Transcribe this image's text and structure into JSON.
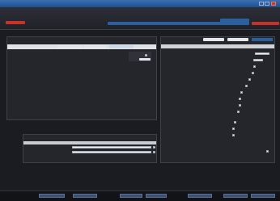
{
  "window": {
    "title": "",
    "menu": [
      "",
      "",
      "",
      "",
      ""
    ]
  },
  "header": {
    "nav": [
      "",
      "",
      "",
      "",
      ""
    ],
    "alert_label": ""
  },
  "left_panel": {
    "title": "",
    "tabs": [
      "",
      "",
      ""
    ],
    "action_button": "",
    "status_label": ""
  },
  "lower_panel": {
    "title": "",
    "rows": [
      {
        "label": "",
        "value": ""
      },
      {
        "label": "",
        "value": ""
      }
    ]
  },
  "right_panel": {
    "title_buttons": [
      "",
      ""
    ],
    "field_labels": [
      "",
      "",
      "",
      "",
      "",
      "",
      "",
      "",
      "",
      "",
      "",
      "",
      ""
    ],
    "footer_label": ""
  },
  "bottom_bar": {
    "buttons": [
      "",
      "",
      "",
      "",
      "",
      "",
      ""
    ]
  },
  "colors": {
    "accent": "#2a5fa0",
    "alert": "#c8322a",
    "background": "#1a1c22"
  }
}
